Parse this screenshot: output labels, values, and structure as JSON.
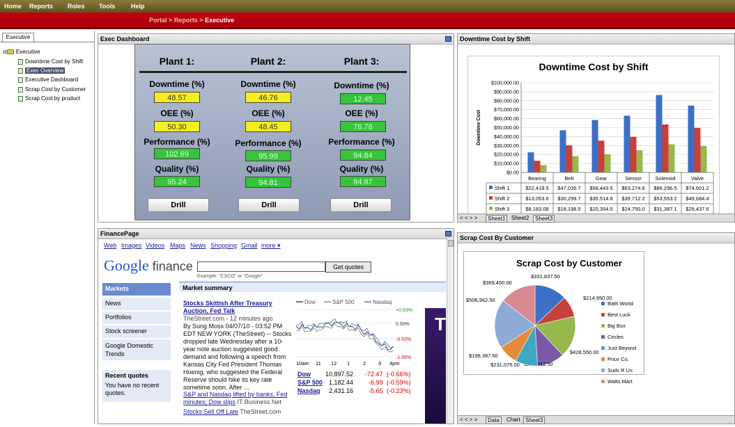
{
  "menu": {
    "items": [
      "Home",
      "Reports",
      "Roles",
      "Tools",
      "Help"
    ]
  },
  "breadcrumb": {
    "parts": [
      "Portal",
      ">",
      "Reports",
      ">",
      "Executive"
    ]
  },
  "sidebar": {
    "tab": "Executive",
    "root": "Executive",
    "items": [
      "Downtime Cost by Shift",
      "Exec Overview",
      "Executive Dashboard",
      "Scrap Cost by Customer",
      "Scrap Cost by product"
    ]
  },
  "exec": {
    "title": "Exec Dashboard",
    "plants": [
      {
        "name": "Plant 1:",
        "downtime": "48.57",
        "oee": "50.30",
        "performance": "102.69",
        "quality": "95.24"
      },
      {
        "name": "Plant 2:",
        "downtime": "46.76",
        "oee": "48.45",
        "performance": "95.99",
        "quality": "94.81"
      },
      {
        "name": "Plant 3:",
        "downtime": "12.45",
        "oee": "78.78",
        "performance": "94.84",
        "quality": "94.87"
      }
    ],
    "labels": {
      "downtime": "Downtime (%)",
      "oee": "OEE (%)",
      "performance": "Performance (%)",
      "quality": "Quality (%)"
    },
    "drill": "Drill",
    "colors": {
      "yellow": "#f4ee20",
      "green": "#36c43a"
    }
  },
  "downtime": {
    "panel_title": "Downtime Cost by Shift",
    "tabs": [
      "Sheet1",
      "Sheet2",
      "Sheet3"
    ],
    "nav": "< < > >",
    "chart_data": {
      "type": "bar",
      "title": "Downtime Cost by Shift",
      "ylabel": "Downtime Cost",
      "xlabel": "",
      "categories": [
        "Bearing",
        "Belt",
        "Gear",
        "Sensor",
        "Solenoid",
        "Valve"
      ],
      "ylim": [
        0,
        100000
      ],
      "yticks": [
        "$100,000.00",
        "$90,000.00",
        "$80,000.00",
        "$70,000.00",
        "$60,000.00",
        "$50,000.00",
        "$40,000.00",
        "$30,000.00",
        "$20,000.00",
        "$10,000.00",
        "$0.00"
      ],
      "series": [
        {
          "name": "Shift 1",
          "color": "#3d6fc6",
          "values": [
            22419.5,
            47035.7,
            58443.5,
            63274.6,
            86296.5,
            74601.2
          ],
          "labels": [
            "$22,419.5",
            "$47,035.7",
            "$58,443.5",
            "$63,274.6",
            "$86,296.5",
            "$74,601.2"
          ]
        },
        {
          "name": "Shift 2",
          "color": "#c8403c",
          "values": [
            13053.6,
            30299.7,
            35514.8,
            39712.2,
            53553.2,
            49684.4
          ],
          "labels": [
            "$13,053.6",
            "$30,299.7",
            "$35,514.8",
            "$39,712.2",
            "$53,553.2",
            "$49,684.4"
          ]
        },
        {
          "name": "Shift 3",
          "color": "#96b84c",
          "values": [
            8183.08,
            18198.5,
            20354.5,
            24750,
            31387.1,
            29437.6
          ],
          "labels": [
            "$8,183.08",
            "$18,198.5",
            "$20,354.5",
            "$24,750.0",
            "$31,387.1",
            "$29,437.6"
          ]
        }
      ]
    }
  },
  "finance": {
    "panel_title": "FinancePage",
    "nav_links": [
      "Web",
      "Images",
      "Videos",
      "Maps",
      "News",
      "Shopping",
      "Gmail",
      "more ▾"
    ],
    "logo_google": "Google",
    "logo_finance": " finance",
    "search_value": "",
    "get_quotes": "Get quotes",
    "example": "Example: \"CSCO\" or \"Google\"",
    "side": [
      "Markets",
      "News",
      "Portfolios",
      "Stock screener",
      "Google Domestic Trends"
    ],
    "recent_title": "Recent quotes",
    "recent_text": "You have no recent quotes.",
    "market_summary": "Market summary",
    "headline": "Stocks Skittish After Treasury Auction, Fed Talk",
    "headline_src": "TheStreet.com - 12 minutes ago",
    "body": "By Sung Moss 04/07/10 - 03:52 PM EDT NEW YORK (TheStreet) -- Stocks dropped late Wednesday after a 10-year note auction suggested good demand and following a speech from Kansas City Fed President Thomas Hoenig, who suggested the Federal Reserve should hike its key rate sometime soon. After ...",
    "link2": "S&P and Nasdaq lifted by banks, Fed minutes; Dow slips",
    "link2_src": " IT Business Net",
    "link3": "Stocks Sell Off Late",
    "link3_src": " TheStreet.com",
    "legend": [
      "Dow",
      "S&P 500",
      "Nasdaq"
    ],
    "mini_ylabels": [
      "+0.53%",
      "0.00%",
      "-0.53%",
      "-1.06%"
    ],
    "mini_xlabels": [
      "10am",
      "11",
      "12",
      "1",
      "2",
      "3",
      "4pm"
    ],
    "quotes": [
      {
        "name": "Dow",
        "value": "10,897.52",
        "change": "-72.47",
        "pct": "(-0.66%)"
      },
      {
        "name": "S&P 500",
        "value": "1,182.44",
        "change": "-6.99",
        "pct": "(-0.59%)"
      },
      {
        "name": "Nasdaq",
        "value": "2,431.16",
        "change": "-5.65",
        "pct": "(-0.23%)"
      }
    ]
  },
  "scrap": {
    "panel_title": "Scrap Cost By Customer",
    "tabs": [
      "Data",
      "Chart",
      "Sheet3"
    ],
    "nav": "< < > >",
    "chart_data": {
      "type": "pie",
      "title": "Scrap Cost by Customer",
      "slices": [
        {
          "label": "Bath World",
          "value": 331837.5,
          "text": "$331,837.50",
          "color": "#3d6fc6"
        },
        {
          "label": "Best Luck",
          "value": 214950.0,
          "text": "$214,950.00",
          "color": "#c8403c"
        },
        {
          "label": "Big Box",
          "value": 428550.0,
          "text": "$428,550.00",
          "color": "#96b84c"
        },
        {
          "label": "Circles",
          "value": 280012.5,
          "text": "$280,012.50",
          "color": "#7a5aa8"
        },
        {
          "label": "Just Beyond",
          "value": 231075.0,
          "text": "$231,075.00",
          "color": "#3ea8c0"
        },
        {
          "label": "Price Co.",
          "value": 199387.5,
          "text": "$199,387.50",
          "color": "#e48a3a"
        },
        {
          "label": "Suds R Us",
          "value": 506962.5,
          "text": "$506,962.50",
          "color": "#8eaad6"
        },
        {
          "label": "Walts Mart",
          "value": 369450.0,
          "text": "$369,450.00",
          "color": "#d88a90"
        }
      ]
    }
  }
}
